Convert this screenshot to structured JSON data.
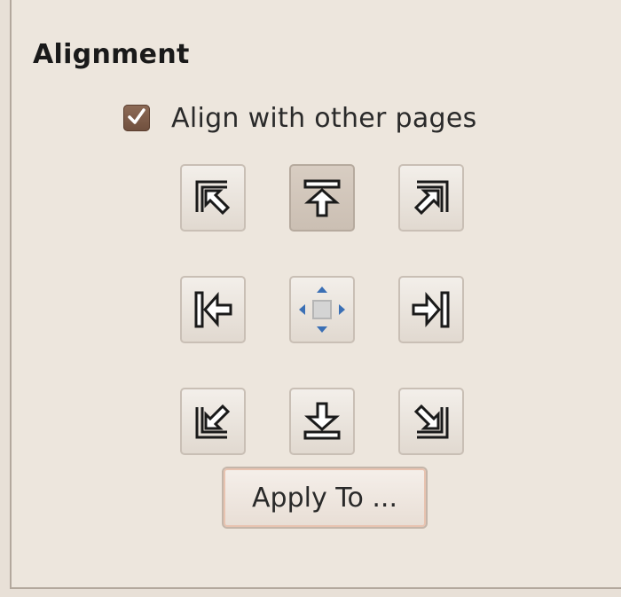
{
  "section": {
    "title": "Alignment"
  },
  "checkbox": {
    "label": "Align with other pages",
    "checked": true
  },
  "alignment_grid": {
    "selected": "top-center",
    "buttons": [
      {
        "name": "align-top-left",
        "icon": "arrow-top-left-icon"
      },
      {
        "name": "align-top-center",
        "icon": "arrow-up-to-line-icon"
      },
      {
        "name": "align-top-right",
        "icon": "arrow-top-right-icon"
      },
      {
        "name": "align-middle-left",
        "icon": "arrow-left-to-line-icon"
      },
      {
        "name": "align-center",
        "icon": "center-move-icon"
      },
      {
        "name": "align-middle-right",
        "icon": "arrow-right-to-line-icon"
      },
      {
        "name": "align-bottom-left",
        "icon": "arrow-bottom-left-icon"
      },
      {
        "name": "align-bottom-center",
        "icon": "arrow-down-to-line-icon"
      },
      {
        "name": "align-bottom-right",
        "icon": "arrow-bottom-right-icon"
      }
    ]
  },
  "apply_button": {
    "label": "Apply To ..."
  },
  "colors": {
    "background": "#e8e0d7",
    "checkbox": "#7d5c49",
    "apply_border_accent": "#e8c3b0"
  }
}
